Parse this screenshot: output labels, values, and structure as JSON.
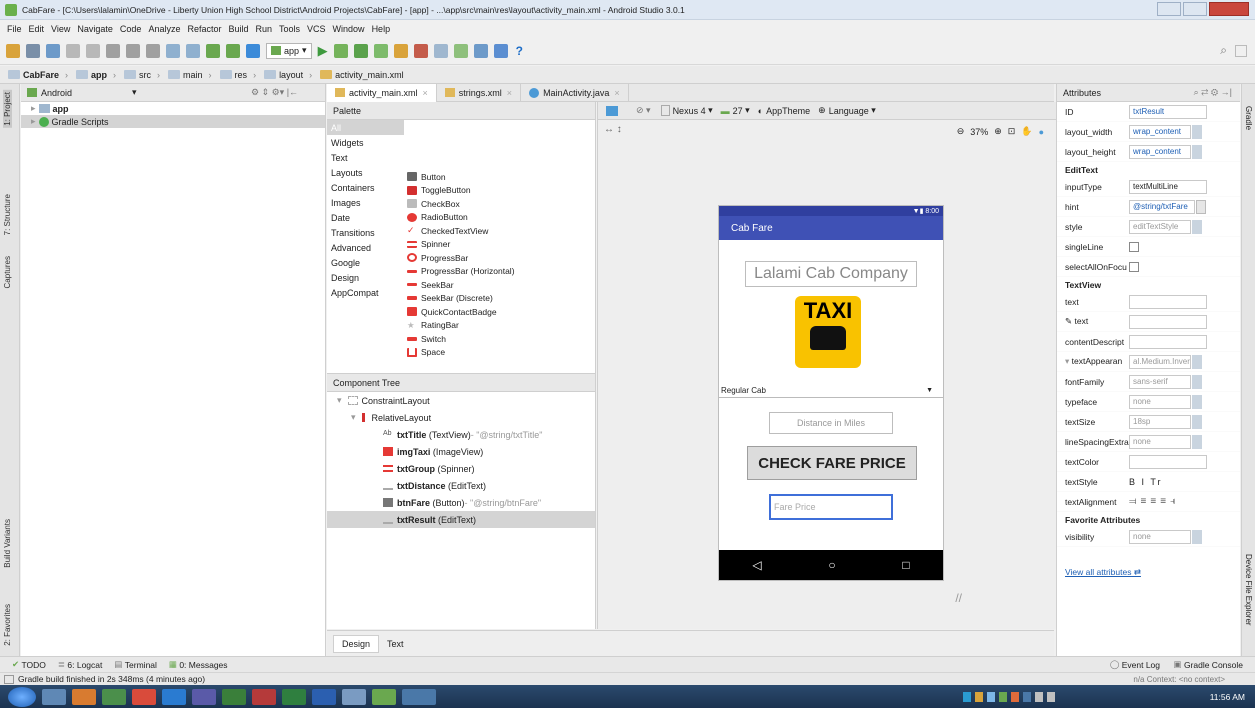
{
  "window": {
    "title": "CabFare - [C:\\Users\\lalamin\\OneDrive - Liberty Union High School District\\Android Projects\\CabFare] - [app] - ...\\app\\src\\main\\res\\layout\\activity_main.xml - Android Studio 3.0.1"
  },
  "menu": [
    "File",
    "Edit",
    "View",
    "Navigate",
    "Code",
    "Analyze",
    "Refactor",
    "Build",
    "Run",
    "Tools",
    "VCS",
    "Window",
    "Help"
  ],
  "toolbar": {
    "run_config": "app"
  },
  "breadcrumbs": [
    "CabFare",
    "app",
    "src",
    "main",
    "res",
    "layout",
    "activity_main.xml"
  ],
  "left_strip": {
    "project": "1: Project",
    "structure": "7: Structure",
    "captures": "Captures",
    "build_variants": "Build Variants",
    "favorites": "2: Favorites"
  },
  "project_panel": {
    "view": "Android",
    "items": [
      "app",
      "Gradle Scripts"
    ]
  },
  "editor_tabs": [
    "activity_main.xml",
    "strings.xml",
    "MainActivity.java"
  ],
  "palette": {
    "title": "Palette",
    "categories": [
      "All",
      "Widgets",
      "Text",
      "Layouts",
      "Containers",
      "Images",
      "Date",
      "Transitions",
      "Advanced",
      "Google",
      "Design",
      "AppCompat"
    ],
    "items": [
      "Button",
      "ToggleButton",
      "CheckBox",
      "RadioButton",
      "CheckedTextView",
      "Spinner",
      "ProgressBar",
      "ProgressBar (Horizontal)",
      "SeekBar",
      "SeekBar (Discrete)",
      "QuickContactBadge",
      "RatingBar",
      "Switch",
      "Space"
    ]
  },
  "component_tree": {
    "title": "Component Tree",
    "root": "ConstraintLayout",
    "child": "RelativeLayout",
    "items": [
      {
        "name": "txtTitle",
        "type": "(TextView)",
        "extra": " - \"@string/txtTitle\""
      },
      {
        "name": "imgTaxi",
        "type": "(ImageView)",
        "extra": ""
      },
      {
        "name": "txtGroup",
        "type": "(Spinner)",
        "extra": ""
      },
      {
        "name": "txtDistance",
        "type": "(EditText)",
        "extra": ""
      },
      {
        "name": "btnFare",
        "type": "(Button)",
        "extra": " - \"@string/btnFare\""
      },
      {
        "name": "txtResult",
        "type": "(EditText)",
        "extra": ""
      }
    ]
  },
  "design_toolbar": {
    "device": "Nexus 4",
    "api": "27",
    "theme": "AppTheme",
    "language": "Language",
    "zoom": "37%"
  },
  "phone": {
    "time": "8:00",
    "app_title": "Cab Fare",
    "header_text": "Lalami Cab Company",
    "taxi_label": "TAXI",
    "spinner_value": "Regular Cab",
    "distance_hint": "Distance in Miles",
    "button_label": "CHECK FARE PRICE",
    "result_hint": "Fare Price"
  },
  "attributes": {
    "title": "Attributes",
    "rows": [
      {
        "name": "ID",
        "value": "txtResult"
      },
      {
        "name": "layout_width",
        "value": "wrap_content"
      },
      {
        "name": "layout_height",
        "value": "wrap_content"
      }
    ],
    "edittext_header": "EditText",
    "edittext_rows": [
      {
        "name": "inputType",
        "value": "textMultiLine"
      },
      {
        "name": "hint",
        "value": "@string/txtFare"
      },
      {
        "name": "style",
        "value": "editTextStyle"
      },
      {
        "name": "singleLine",
        "value": ""
      },
      {
        "name": "selectAllOnFocu",
        "value": ""
      }
    ],
    "textview_header": "TextView",
    "textview_rows": [
      {
        "name": "text",
        "value": ""
      },
      {
        "name": "text",
        "value": ""
      },
      {
        "name": "contentDescript",
        "value": ""
      },
      {
        "name": "textAppearan",
        "value": "al.Medium.Inverse"
      },
      {
        "name": "fontFamily",
        "value": "sans-serif"
      },
      {
        "name": "typeface",
        "value": "none"
      },
      {
        "name": "textSize",
        "value": "18sp"
      },
      {
        "name": "lineSpacingExtra",
        "value": "none"
      },
      {
        "name": "textColor",
        "value": ""
      },
      {
        "name": "textStyle",
        "value": "B  I  Tr"
      },
      {
        "name": "textAlignment",
        "value": ""
      }
    ],
    "favorites_header": "Favorite Attributes",
    "fav_rows": [
      {
        "name": "visibility",
        "value": "none"
      }
    ],
    "view_all": "View all attributes"
  },
  "design_tabs": [
    "Design",
    "Text"
  ],
  "bottom_tabs": [
    "TODO",
    "6: Logcat",
    "Terminal",
    "0: Messages"
  ],
  "bottom_right": [
    "Event Log",
    "Gradle Console"
  ],
  "right_strip": {
    "gradle": "Gradle",
    "device_file_explorer": "Device File Explorer"
  },
  "statusbar": {
    "message": "Gradle build finished in 2s 348ms (4 minutes ago)",
    "right": "n/a   Context: <no context>"
  },
  "taskbar": {
    "time": "11:56 AM"
  }
}
